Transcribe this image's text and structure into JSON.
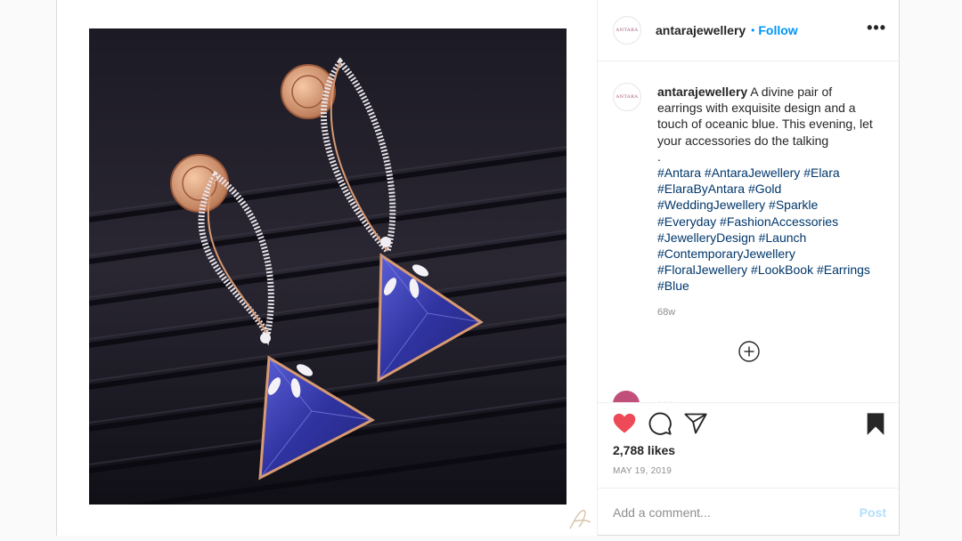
{
  "post": {
    "brand_mark": "ANTARA",
    "username": "antarajewellery",
    "follow_separator": "•",
    "follow_label": "Follow",
    "more_label": "•••",
    "caption_text": "A divine pair of earrings with exquisite design and a touch of oceanic blue. This evening, let your accessories do the talking",
    "caption_break": ".",
    "hashtags": "#Antara #AntaraJewellery #Elara #ElaraByAntara #Gold #WeddingJewellery #Sparkle #Everyday #FashionAccessories #JewelleryDesign #Launch #ContemporaryJewellery #FloralJewellery #LookBook #Earrings #Blue",
    "time_ago": "68w",
    "peek_comment": "...",
    "likes": "2,788 likes",
    "date": "MAY 19, 2019",
    "comment_placeholder": "Add a comment...",
    "post_label": "Post",
    "photo_alt": "Pair of rose-gold earrings with diamond-studded leaf frames and blue triangular gemstones on dark velvet",
    "colors": {
      "accent": "#0095f6",
      "heart": "#ed4956",
      "text": "#262626",
      "muted": "#8e8e8e",
      "hashtag": "#00376b",
      "gem": "#3a3fb0",
      "rose_gold": "#d89a72"
    },
    "icons": [
      "heart-icon",
      "comment-icon",
      "share-icon",
      "bookmark-icon",
      "add-comment-icon",
      "more-options-icon",
      "watermark-logo-icon"
    ],
    "state": {
      "liked": true,
      "saved": true
    }
  }
}
